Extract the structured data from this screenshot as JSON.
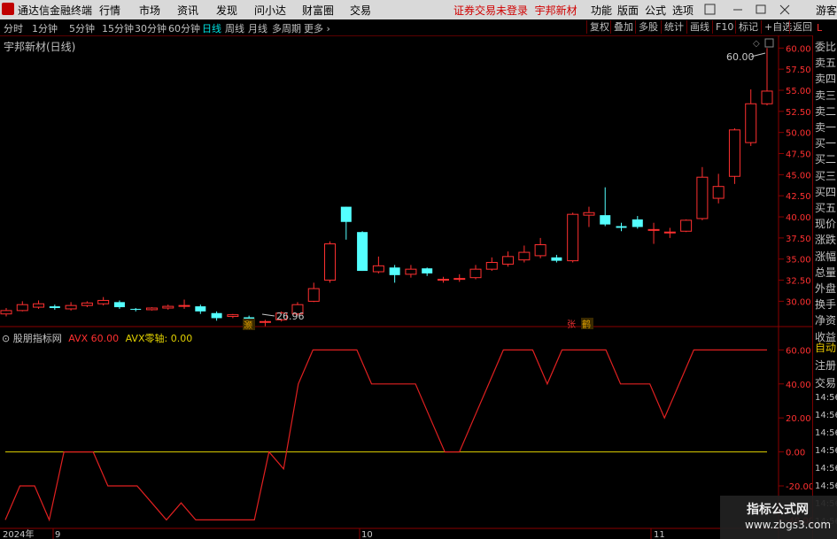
{
  "titlebar": {
    "app_title": "通达信金融终端",
    "menus": [
      "行情",
      "市场",
      "资讯",
      "发现",
      "问小达",
      "财富圈",
      "交易"
    ],
    "warning": "证券交易未登录",
    "stock": "宇邦新材",
    "right_menus": [
      "功能",
      "版面",
      "公式",
      "选项"
    ],
    "guest": "游客"
  },
  "toolbar": {
    "periods": [
      "分时",
      "1分钟",
      "5分钟",
      "15分钟",
      "30分钟",
      "60分钟",
      "日线",
      "周线",
      "月线",
      "多周期",
      "更多"
    ],
    "active_period": "日线",
    "buttons": [
      "复权",
      "叠加",
      "多股",
      "统计",
      "画线",
      "F10",
      "标记",
      "+自选",
      "返回"
    ]
  },
  "main_chart": {
    "stock_label": "宇邦新材(日线)",
    "high_label": "60.00",
    "low_label": "26.96",
    "marker_1": "灏",
    "marker_2": "张",
    "marker_3": "鹤"
  },
  "right_panel": {
    "items": [
      "委比",
      "卖五",
      "卖四",
      "卖三",
      "卖二",
      "卖一",
      "买一",
      "买二",
      "买三",
      "买四",
      "买五",
      "现价",
      "涨跌",
      "涨幅",
      "总量",
      "外盘",
      "换手",
      "净资",
      "收益"
    ],
    "bottom": [
      "自动",
      "注册",
      "交易",
      "14:56",
      "14:56",
      "14:56",
      "14:56",
      "14:56",
      "14:56",
      "14:56",
      "14:56"
    ]
  },
  "indicator": {
    "name": "股朋指标网",
    "avx_label": "AVX",
    "avx_value": "60.00",
    "zero_label": "AVX零轴:",
    "zero_value": "0.00"
  },
  "x_axis": {
    "year": "2024年",
    "months": [
      "9",
      "10",
      "11"
    ]
  },
  "watermark": {
    "cn": "指标公式网",
    "url": "www.zbgs3.com"
  },
  "chart_data": {
    "type": "candlestick",
    "price_axis": {
      "ylim": [
        27,
        61.5
      ],
      "ticks": [
        "60.00",
        "57.50",
        "55.00",
        "52.50",
        "50.00",
        "47.50",
        "45.00",
        "42.50",
        "40.00",
        "37.50",
        "35.00",
        "32.50",
        "30.00"
      ]
    },
    "candles": [
      {
        "o": 28.5,
        "c": 28.9,
        "h": 29.2,
        "l": 28.2
      },
      {
        "o": 28.9,
        "c": 29.6,
        "h": 30.0,
        "l": 28.8
      },
      {
        "o": 29.3,
        "c": 29.7,
        "h": 30.1,
        "l": 29.1
      },
      {
        "o": 29.4,
        "c": 29.2,
        "h": 29.6,
        "l": 29.0
      },
      {
        "o": 29.1,
        "c": 29.5,
        "h": 29.9,
        "l": 28.9
      },
      {
        "o": 29.5,
        "c": 29.8,
        "h": 30.0,
        "l": 29.3
      },
      {
        "o": 29.7,
        "c": 30.1,
        "h": 30.5,
        "l": 29.5
      },
      {
        "o": 29.9,
        "c": 29.3,
        "h": 30.1,
        "l": 29.1
      },
      {
        "o": 29.1,
        "c": 29.0,
        "h": 29.2,
        "l": 28.8
      },
      {
        "o": 29.0,
        "c": 29.2,
        "h": 29.3,
        "l": 28.9
      },
      {
        "o": 29.2,
        "c": 29.4,
        "h": 29.6,
        "l": 29.0
      },
      {
        "o": 29.5,
        "c": 29.5,
        "h": 30.2,
        "l": 29.1
      },
      {
        "o": 29.4,
        "c": 28.8,
        "h": 29.6,
        "l": 28.5
      },
      {
        "o": 28.6,
        "c": 28.0,
        "h": 28.8,
        "l": 27.7
      },
      {
        "o": 28.2,
        "c": 28.4,
        "h": 28.5,
        "l": 28.0
      },
      {
        "o": 28.1,
        "c": 27.7,
        "h": 28.3,
        "l": 27.3
      },
      {
        "o": 27.6,
        "c": 27.6,
        "h": 27.8,
        "l": 26.96
      },
      {
        "o": 27.8,
        "c": 28.6,
        "h": 28.8,
        "l": 27.6
      },
      {
        "o": 28.5,
        "c": 29.6,
        "h": 29.9,
        "l": 28.3
      },
      {
        "o": 30.0,
        "c": 31.5,
        "h": 32.2,
        "l": 29.9
      },
      {
        "o": 32.5,
        "c": 36.8,
        "h": 37.1,
        "l": 32.2
      },
      {
        "o": 41.2,
        "c": 39.4,
        "h": 41.2,
        "l": 37.3
      },
      {
        "o": 38.2,
        "c": 33.6,
        "h": 38.3,
        "l": 33.6
      },
      {
        "o": 33.5,
        "c": 34.2,
        "h": 35.3,
        "l": 33.3
      },
      {
        "o": 34.0,
        "c": 33.1,
        "h": 34.3,
        "l": 32.2
      },
      {
        "o": 33.2,
        "c": 33.8,
        "h": 34.3,
        "l": 32.8
      },
      {
        "o": 33.9,
        "c": 33.3,
        "h": 34.0,
        "l": 33.0
      },
      {
        "o": 32.6,
        "c": 32.6,
        "h": 32.9,
        "l": 32.2
      },
      {
        "o": 32.6,
        "c": 32.7,
        "h": 33.2,
        "l": 32.3
      },
      {
        "o": 32.8,
        "c": 33.8,
        "h": 34.3,
        "l": 32.6
      },
      {
        "o": 33.8,
        "c": 34.6,
        "h": 35.2,
        "l": 33.6
      },
      {
        "o": 34.4,
        "c": 35.3,
        "h": 35.9,
        "l": 34.1
      },
      {
        "o": 34.9,
        "c": 35.8,
        "h": 36.6,
        "l": 34.6
      },
      {
        "o": 35.4,
        "c": 36.7,
        "h": 37.5,
        "l": 35.1
      },
      {
        "o": 35.2,
        "c": 34.8,
        "h": 35.5,
        "l": 34.6
      },
      {
        "o": 34.8,
        "c": 40.3,
        "h": 40.5,
        "l": 34.6
      },
      {
        "o": 40.2,
        "c": 40.5,
        "h": 41.2,
        "l": 38.8
      },
      {
        "o": 40.2,
        "c": 39.1,
        "h": 43.5,
        "l": 38.9
      },
      {
        "o": 38.9,
        "c": 38.7,
        "h": 39.3,
        "l": 38.3
      },
      {
        "o": 39.7,
        "c": 38.8,
        "h": 40.1,
        "l": 38.6
      },
      {
        "o": 38.5,
        "c": 38.5,
        "h": 39.3,
        "l": 36.8
      },
      {
        "o": 38.2,
        "c": 38.2,
        "h": 38.7,
        "l": 37.5
      },
      {
        "o": 38.3,
        "c": 39.6,
        "h": 39.7,
        "l": 38.2
      },
      {
        "o": 39.8,
        "c": 44.7,
        "h": 45.9,
        "l": 39.6
      },
      {
        "o": 42.2,
        "c": 43.6,
        "h": 45.1,
        "l": 41.6
      },
      {
        "o": 44.8,
        "c": 50.3,
        "h": 50.5,
        "l": 43.9
      },
      {
        "o": 48.8,
        "c": 53.4,
        "h": 55.1,
        "l": 48.4
      },
      {
        "o": 53.4,
        "c": 54.9,
        "h": 60.0,
        "l": 53.2
      }
    ],
    "indicator": {
      "name": "AVX",
      "ylim": [
        -45,
        68
      ],
      "ticks": [
        "60.00",
        "40.00",
        "20.00",
        "0.00",
        "-20.00",
        "-40.00"
      ],
      "zero_line": 0,
      "values": [
        -40,
        -20,
        -20,
        -40,
        0,
        0,
        0,
        -20,
        -20,
        -20,
        -30,
        -40,
        -30,
        -40,
        -40,
        -40,
        -40,
        -40,
        0,
        -10,
        40,
        60,
        60,
        60,
        60,
        40,
        40,
        40,
        40,
        20,
        0,
        0,
        20,
        40,
        60,
        60,
        60,
        40,
        60,
        60,
        60,
        60,
        40,
        40,
        40,
        20,
        40,
        60,
        60,
        60,
        60,
        60,
        60
      ]
    }
  }
}
